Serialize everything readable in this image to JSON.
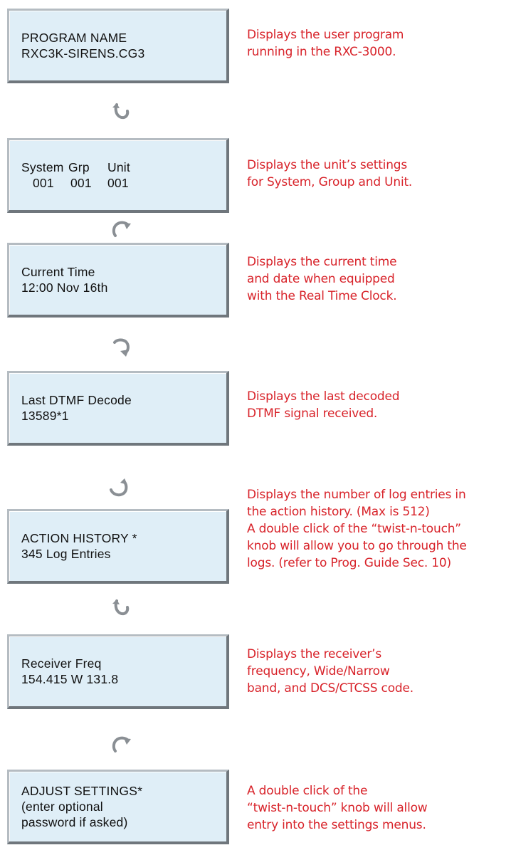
{
  "screens": [
    {
      "lines": [
        "PROGRAM NAME",
        "RXC3K-SIRENS.CG3"
      ],
      "description": [
        "Displays the user program",
        "running in the RXC-3000."
      ]
    },
    {
      "labels": [
        "System",
        "Grp",
        "Unit"
      ],
      "values": [
        "001",
        "001",
        "001"
      ],
      "description": [
        "Displays the unit’s settings",
        "for System, Group and Unit."
      ]
    },
    {
      "lines": [
        "Current Time",
        "12:00 Nov 16th"
      ],
      "description": [
        "Displays the current time",
        "and date when equipped",
        "with the Real Time Clock."
      ]
    },
    {
      "lines": [
        "Last DTMF Decode",
        "13589*1"
      ],
      "description": [
        "Displays the last decoded",
        "DTMF signal received."
      ]
    },
    {
      "lines": [
        "ACTION HISTORY *",
        "345 Log Entries"
      ],
      "description": [
        "Displays the number of log entries in",
        "the action history. (Max is 512)",
        "A double click of the “twist-n-touch”",
        "knob will allow you to go through the",
        "logs. (refer to Prog. Guide Sec. 10)"
      ]
    },
    {
      "lines": [
        "Receiver Freq",
        "154.415 W 131.8"
      ],
      "description": [
        "Displays the receiver’s",
        "frequency, Wide/Narrow",
        "band, and DCS/CTCSS code."
      ]
    },
    {
      "lines": [
        "ADJUST SETTINGS*",
        "(enter optional",
        "password if asked)"
      ],
      "description": [
        "A double click of the",
        "“twist-n-touch” knob will allow",
        "entry into the settings menus."
      ]
    }
  ],
  "arrows": [
    {
      "icon": "rotate-counterclockwise-icon"
    },
    {
      "icon": "rotate-clockwise-icon"
    },
    {
      "icon": "rotate-clockwise-down-icon"
    },
    {
      "icon": "rotate-counterclockwise-down-icon"
    },
    {
      "icon": "rotate-counterclockwise-icon"
    },
    {
      "icon": "rotate-clockwise-icon"
    }
  ],
  "colors": {
    "description_text": "#d8232a",
    "screen_bg": "#dfeef7",
    "arrow": "#7a7f84"
  }
}
